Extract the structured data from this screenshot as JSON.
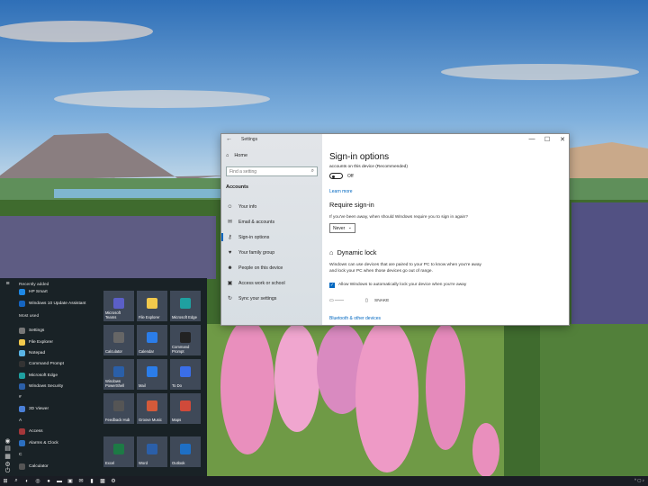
{
  "settings": {
    "window_title": "Settings",
    "back_glyph": "←",
    "minimize_glyph": "—",
    "maximize_glyph": "☐",
    "close_glyph": "✕",
    "home_label": "Home",
    "search_placeholder": "Find a setting",
    "section_title": "Accounts",
    "nav_items": [
      {
        "label": "Your info",
        "icon": "person-icon"
      },
      {
        "label": "Email & accounts",
        "icon": "mail-icon"
      },
      {
        "label": "Sign-in options",
        "icon": "key-icon",
        "selected": true
      },
      {
        "label": "Your family group",
        "icon": "family-icon"
      },
      {
        "label": "People on this device",
        "icon": "people-icon"
      },
      {
        "label": "Access work or school",
        "icon": "briefcase-icon"
      },
      {
        "label": "Sync your settings",
        "icon": "sync-icon"
      }
    ],
    "page_title": "Sign-in options",
    "partial_note": "accounts on this device (Recommended)",
    "toggle_state": "Off",
    "learn_more": "Learn more",
    "require_heading": "Require sign-in",
    "require_text": "If you've been away, when should Windows require you to sign in again?",
    "require_value": "Never",
    "dynamic_heading": "Dynamic lock",
    "dynamic_text": "Windows can use devices that are paired to your PC to know when you're away and lock your PC when those devices go out of range.",
    "dynamic_checkbox": "Allow Windows to automatically lock your device when you're away",
    "paired_device": "SNAKE",
    "bluetooth_link": "Bluetooth & other devices"
  },
  "start": {
    "recently_added_label": "Recently added",
    "most_used_label": "Most used",
    "apps": [
      {
        "label": "HP Smart",
        "color": "#1e88e5"
      },
      {
        "label": "Windows 10 Update Assistant",
        "color": "#1565c0"
      },
      {
        "label": "Settings",
        "color": "#777777"
      },
      {
        "label": "File Explorer",
        "color": "#f2c94c"
      },
      {
        "label": "Notepad",
        "color": "#5ab4e5"
      },
      {
        "label": "Command Prompt",
        "color": "#333333"
      },
      {
        "label": "Microsoft Edge",
        "color": "#1fa0a0"
      },
      {
        "label": "Windows Security",
        "color": "#2b5fa8"
      },
      {
        "label": "#",
        "color": ""
      },
      {
        "label": "3D Viewer",
        "color": "#4a7fd6"
      },
      {
        "label": "A",
        "color": ""
      },
      {
        "label": "Access",
        "color": "#a4373a"
      },
      {
        "label": "Alarms & Clock",
        "color": "#2c6fbf"
      },
      {
        "label": "C",
        "color": ""
      },
      {
        "label": "Calculator",
        "color": "#555555"
      }
    ],
    "tiles": [
      {
        "label": "Microsoft Teams",
        "color": "#5b5fc7"
      },
      {
        "label": "File Explorer",
        "color": "#f2c94c"
      },
      {
        "label": "Microsoft Edge",
        "color": "#1fa0a0"
      },
      {
        "label": "Calculator",
        "color": "#666666"
      },
      {
        "label": "Calendar",
        "color": "#2b7de9"
      },
      {
        "label": "Command Prompt",
        "color": "#222222"
      },
      {
        "label": "Windows PowerShell",
        "color": "#2a5fa8"
      },
      {
        "label": "Mail",
        "color": "#2b7de9"
      },
      {
        "label": "To Do",
        "color": "#3a6ee8"
      },
      {
        "label": "Feedback Hub",
        "color": "#555555"
      },
      {
        "label": "Groove Music",
        "color": "#d35a3a"
      },
      {
        "label": "Maps",
        "color": "#d04a3a"
      },
      {
        "label": "Excel",
        "color": "#1d7a45"
      },
      {
        "label": "Word",
        "color": "#2b5fa8"
      },
      {
        "label": "Outlook",
        "color": "#1e6fc4"
      }
    ]
  },
  "taskbar": {
    "icons": [
      "windows-icon",
      "search-icon",
      "edge-icon",
      "chrome-icon",
      "firefox-icon",
      "folder-icon",
      "store-icon",
      "mail-icon",
      "terminal-icon",
      "photos-icon",
      "settings-icon"
    ],
    "tray_text": "^  ▢  ♪"
  }
}
